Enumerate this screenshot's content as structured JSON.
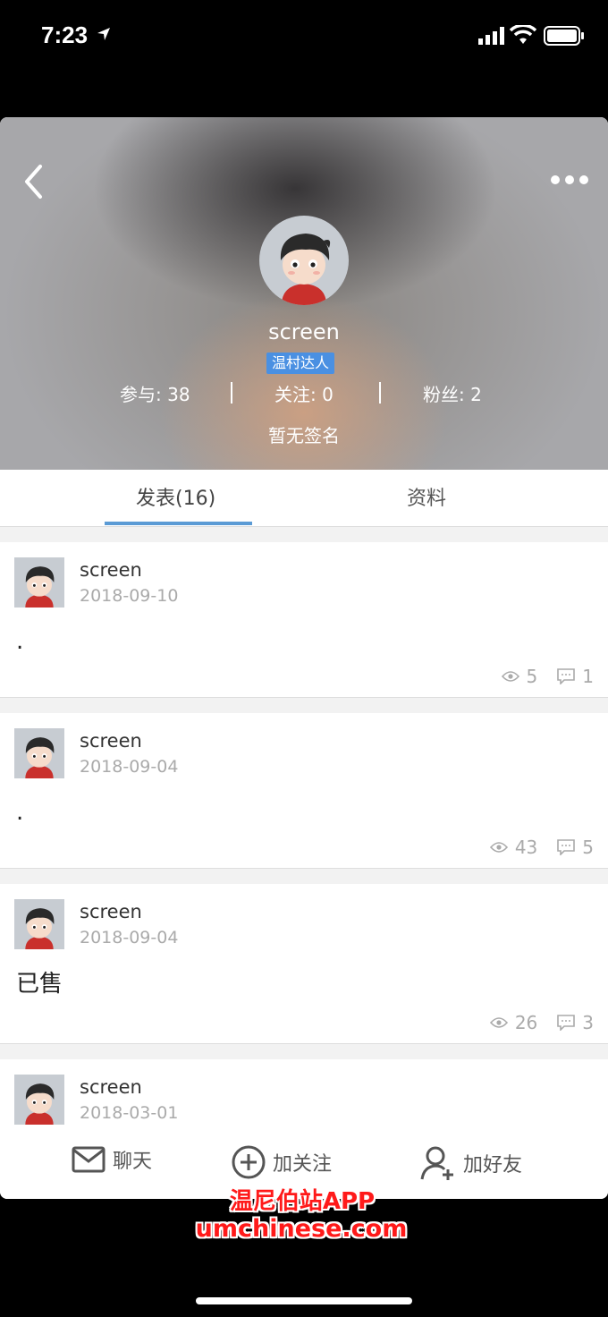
{
  "status_bar": {
    "time": "7:23"
  },
  "profile": {
    "name": "screen",
    "badge": "温村达人",
    "stats": [
      "参与: 38",
      "关注: 0",
      "粉丝: 2"
    ],
    "signature": "暂无签名"
  },
  "tabs": [
    {
      "label": "发表(16)",
      "active": true
    },
    {
      "label": "资料",
      "active": false
    }
  ],
  "posts": [
    {
      "author": "screen",
      "date": "2018-09-10",
      "content": ".",
      "views": "5",
      "comments": "1"
    },
    {
      "author": "screen",
      "date": "2018-09-04",
      "content": ".",
      "views": "43",
      "comments": "5"
    },
    {
      "author": "screen",
      "date": "2018-09-04",
      "content": "已售",
      "views": "26",
      "comments": "3"
    },
    {
      "author": "screen",
      "date": "2018-03-01",
      "content": "",
      "views": "",
      "comments": ""
    }
  ],
  "bottom_actions": {
    "chat": "聊天",
    "follow": "加关注",
    "add_friend": "加好友"
  },
  "watermark": {
    "line1": "温尼伯站APP",
    "line2": "umchinese.com"
  },
  "icons": {
    "back": "back-chevron-icon",
    "more": "more-dots-icon",
    "views": "eye-icon",
    "comments": "comment-icon",
    "chat": "mail-icon",
    "follow": "plus-circle-icon",
    "add_friend": "add-user-icon"
  },
  "colors": {
    "accent": "#5b9bd5",
    "badge": "#4a90e2",
    "watermark": "#ff1a1a"
  }
}
